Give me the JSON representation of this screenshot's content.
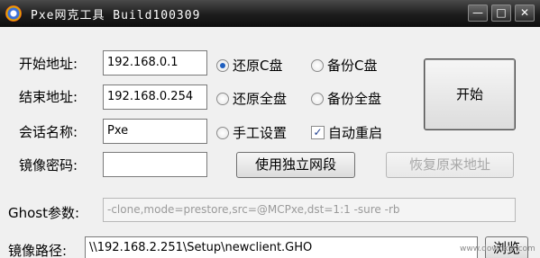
{
  "window": {
    "title": "Pxe网克工具 Build100309",
    "minimize": "—",
    "maximize": "□",
    "close": "✕"
  },
  "form": {
    "start_label": "开始地址:",
    "start_value": "192.168.0.1",
    "end_label": "结束地址:",
    "end_value": "192.168.0.254",
    "session_label": "会话名称:",
    "session_value": "Pxe",
    "password_label": "镜像密码:",
    "password_value": "",
    "ghost_label": "Ghost参数:",
    "ghost_value": "-clone,mode=prestore,src=@MCPxe,dst=1:1 -sure -rb",
    "path_label": "镜像路径:",
    "path_value": "\\\\192.168.2.251\\Setup\\newclient.GHO"
  },
  "options": {
    "restore_c": {
      "label": "还原C盘",
      "checked": true
    },
    "backup_c": {
      "label": "备份C盘",
      "checked": false
    },
    "restore_all": {
      "label": "还原全盘",
      "checked": false
    },
    "backup_all": {
      "label": "备份全盘",
      "checked": false
    },
    "manual": {
      "label": "手工设置",
      "checked": false
    },
    "auto_restart": {
      "label": "自动重启",
      "checked": true
    }
  },
  "buttons": {
    "start": "开始",
    "use_segment": "使用独立网段",
    "restore_address": "恢复原来地址",
    "browse": "浏览"
  },
  "watermark": "www.downxia.com"
}
